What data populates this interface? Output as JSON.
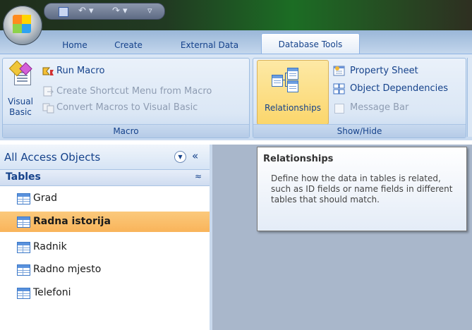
{
  "quick_access": {
    "icons": [
      "save-icon",
      "undo-icon",
      "redo-icon",
      "customize-icon"
    ],
    "undo_glyph": "↶ ▾",
    "redo_glyph": "↷ ▾",
    "custom_glyph": "▿"
  },
  "tabs": [
    {
      "label": "Home",
      "active": false
    },
    {
      "label": "Create",
      "active": false
    },
    {
      "label": "External Data",
      "active": false
    },
    {
      "label": "Database Tools",
      "active": true
    }
  ],
  "ribbon": {
    "macro_group": {
      "label": "Macro",
      "visual_basic": {
        "line1": "Visual",
        "line2": "Basic"
      },
      "run_macro": "Run Macro",
      "create_shortcut_menu": "Create Shortcut Menu from Macro",
      "convert_macros": "Convert Macros to Visual Basic"
    },
    "showhide_group": {
      "label": "Show/Hide",
      "relationships": "Relationships",
      "property_sheet": "Property Sheet",
      "object_dependencies": "Object Dependencies",
      "message_bar": "Message Bar"
    }
  },
  "nav_pane": {
    "title": "All Access Objects",
    "dropdown_glyph": "▼",
    "collapse_glyph": "«",
    "section": {
      "label": "Tables",
      "chevron": "≈"
    },
    "items": [
      {
        "label": "Grad",
        "selected": false
      },
      {
        "label": "Radna istorija",
        "selected": true
      },
      {
        "label": "Radnik",
        "selected": false
      },
      {
        "label": "Radno mjesto",
        "selected": false
      },
      {
        "label": "Telefoni",
        "selected": false
      }
    ]
  },
  "tooltip": {
    "title": "Relationships",
    "body": "Define how the data in tables is related, such as ID fields or name fields in different tables that should match."
  },
  "colors": {
    "ribbon_text": "#15428b",
    "selection": "#f9b45a",
    "workspace": "#a9b7cb"
  }
}
